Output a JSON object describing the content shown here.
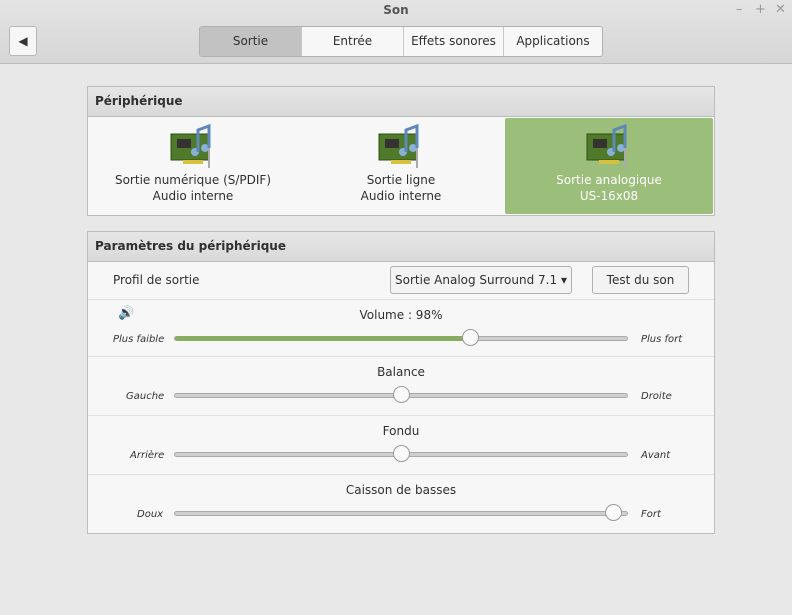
{
  "window": {
    "title": "Son",
    "controls": [
      "–",
      "+",
      "✕"
    ]
  },
  "tabs": [
    "Sortie",
    "Entrée",
    "Effets sonores",
    "Applications"
  ],
  "device_panel": {
    "title": "Périphérique",
    "devices": [
      {
        "name": "Sortie numérique (S/PDIF)",
        "sub": "Audio interne"
      },
      {
        "name": "Sortie ligne",
        "sub": "Audio interne"
      },
      {
        "name": "Sortie analogique",
        "sub": "US-16x08"
      }
    ]
  },
  "settings": {
    "title": "Paramètres du périphérique",
    "profile_label": "Profil de sortie",
    "profile_value": "Sortie Analog Surround 7.1",
    "test_button": "Test du son",
    "volume": {
      "label": "Volume : 98%",
      "min": "Plus faible",
      "max": "Plus fort",
      "value_percent": 98,
      "max_percent": 150
    },
    "balance": {
      "label": "Balance",
      "min": "Gauche",
      "max": "Droite",
      "value": 0.5
    },
    "fade": {
      "label": "Fondu",
      "min": "Arrière",
      "max": "Avant",
      "value": 0.5
    },
    "subwoofer": {
      "label": "Caisson de basses",
      "min": "Doux",
      "max": "Fort",
      "value": 0.97
    }
  },
  "colors": {
    "accent": "#9bbe7b",
    "fill": "#88ad62"
  }
}
